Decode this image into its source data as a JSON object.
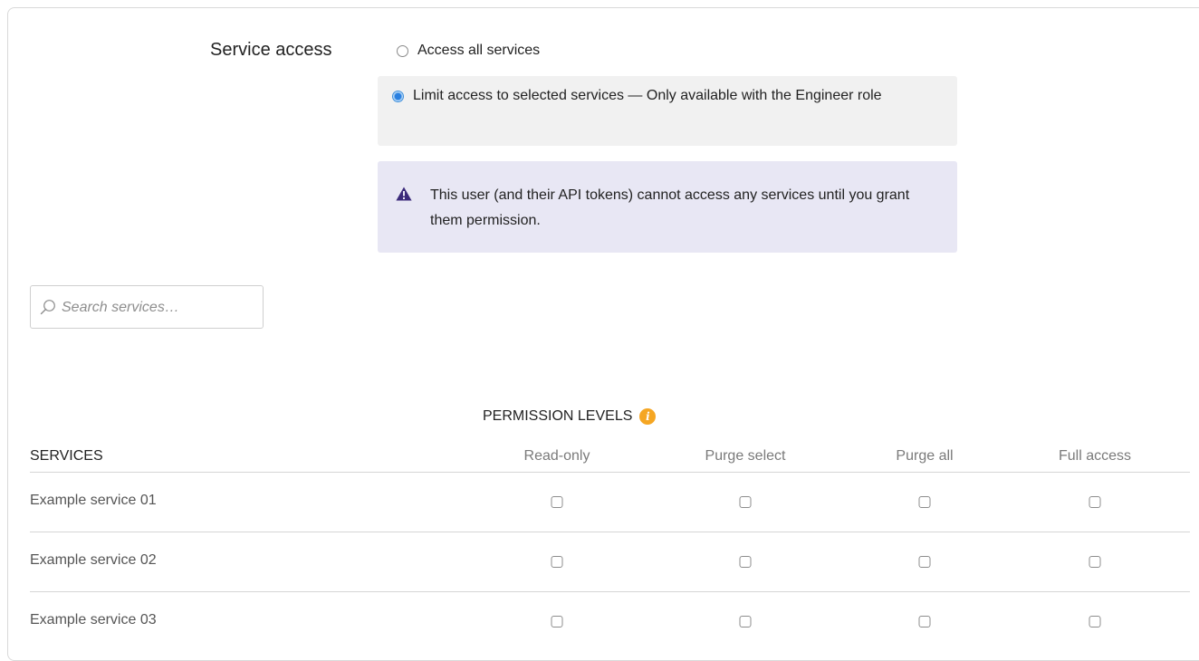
{
  "service_access": {
    "label": "Service access",
    "options": [
      {
        "label": "Access all services",
        "selected": false
      },
      {
        "label": "Limit access to selected services — Only available with the Engineer role",
        "selected": true
      }
    ]
  },
  "warning": {
    "icon": "warning-triangle-icon",
    "icon_color": "#3b2a7a",
    "text": "This user (and their API tokens) cannot access any services until you grant them permission.",
    "background": "#e8e7f4"
  },
  "search": {
    "placeholder": "Search services…",
    "value": ""
  },
  "permission_levels": {
    "title": "PERMISSION LEVELS",
    "info_icon": "info-icon",
    "info_color": "#f5a623"
  },
  "table": {
    "services_header": "SERVICES",
    "columns": [
      "Read-only",
      "Purge select",
      "Purge all",
      "Full access"
    ],
    "rows": [
      {
        "name": "Example service 01",
        "checks": [
          false,
          false,
          false,
          false
        ]
      },
      {
        "name": "Example service 02",
        "checks": [
          false,
          false,
          false,
          false
        ]
      },
      {
        "name": "Example service 03",
        "checks": [
          false,
          false,
          false,
          false
        ]
      }
    ]
  }
}
